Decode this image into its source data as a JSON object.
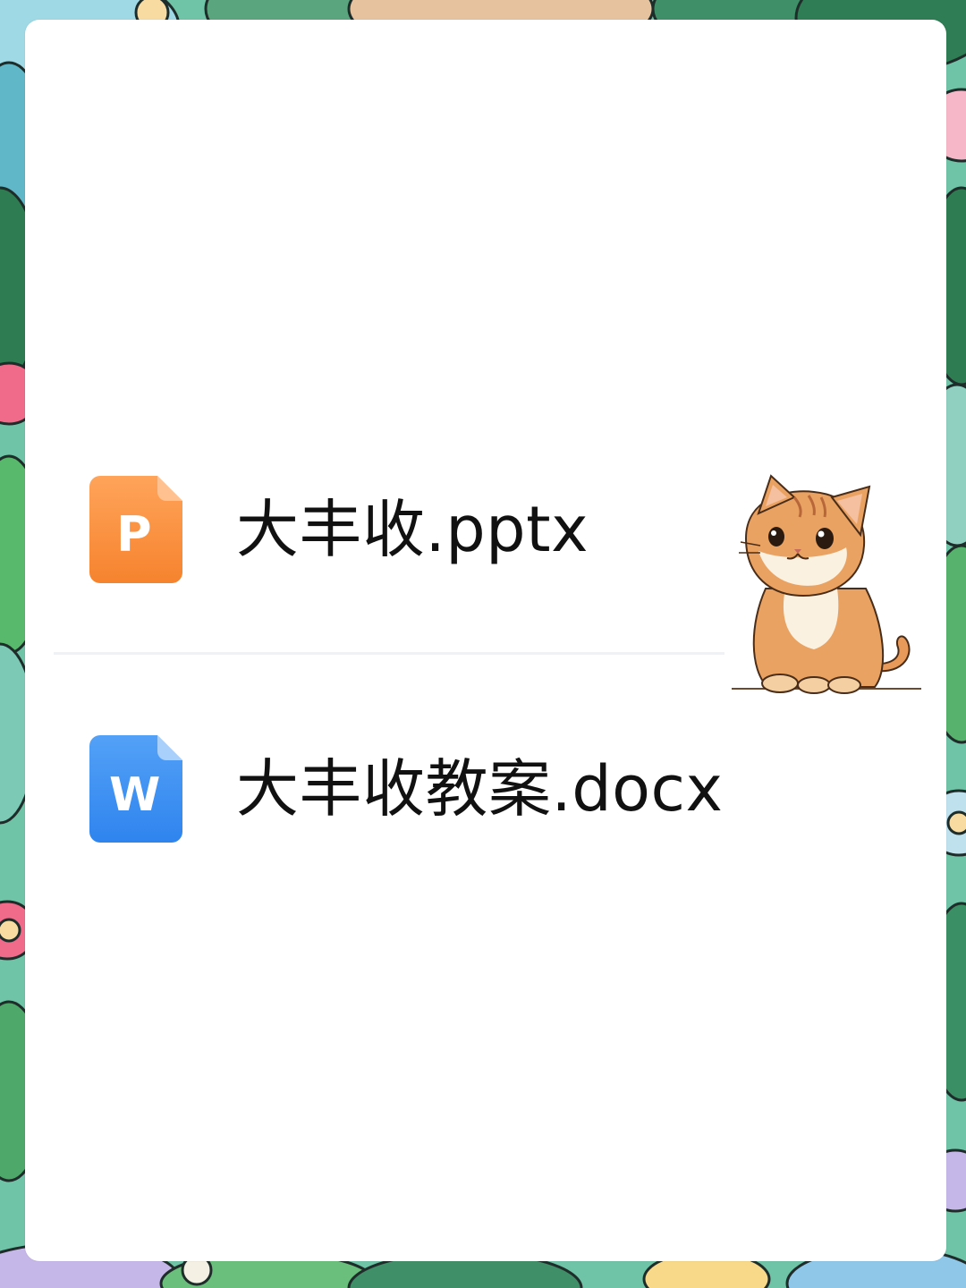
{
  "files": [
    {
      "name": "大丰收.pptx",
      "icon": "powerpoint-file-icon",
      "icon_letter": "P",
      "color": "#f7893a"
    },
    {
      "name": "大丰收教案.docx",
      "icon": "word-file-icon",
      "icon_letter": "W",
      "color": "#3a8ef3"
    }
  ],
  "decoration": {
    "sticker": "cat-sticker",
    "background": "floral-border"
  }
}
